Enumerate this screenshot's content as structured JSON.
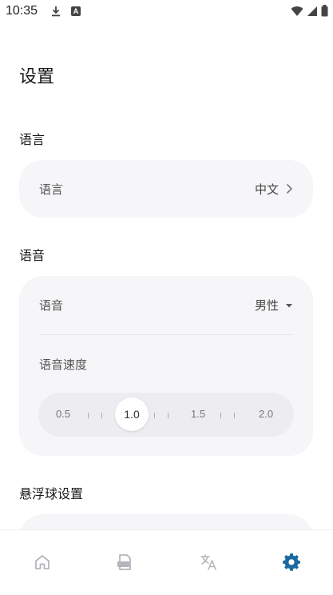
{
  "status_bar": {
    "time": "10:35",
    "notif_letter": "A"
  },
  "page": {
    "title": "设置"
  },
  "language_section": {
    "header": "语言",
    "label": "语言",
    "value": "中文"
  },
  "voice_section": {
    "header": "语音",
    "voice_label": "语音",
    "voice_value": "男性",
    "speed_label": "语音速度",
    "speed_ticks": [
      "0.5",
      "1.0",
      "1.5",
      "2.0"
    ],
    "speed_selected": "1.0"
  },
  "float_section": {
    "header": "悬浮球设置"
  },
  "bottom_nav": {
    "items": [
      {
        "icon": "home-icon",
        "active": false
      },
      {
        "icon": "document-icon",
        "active": false
      },
      {
        "icon": "translate-icon",
        "active": false
      },
      {
        "icon": "gear-icon",
        "active": true
      }
    ],
    "active_color": "#1a6aa0",
    "inactive_color": "#b5b5bd"
  }
}
